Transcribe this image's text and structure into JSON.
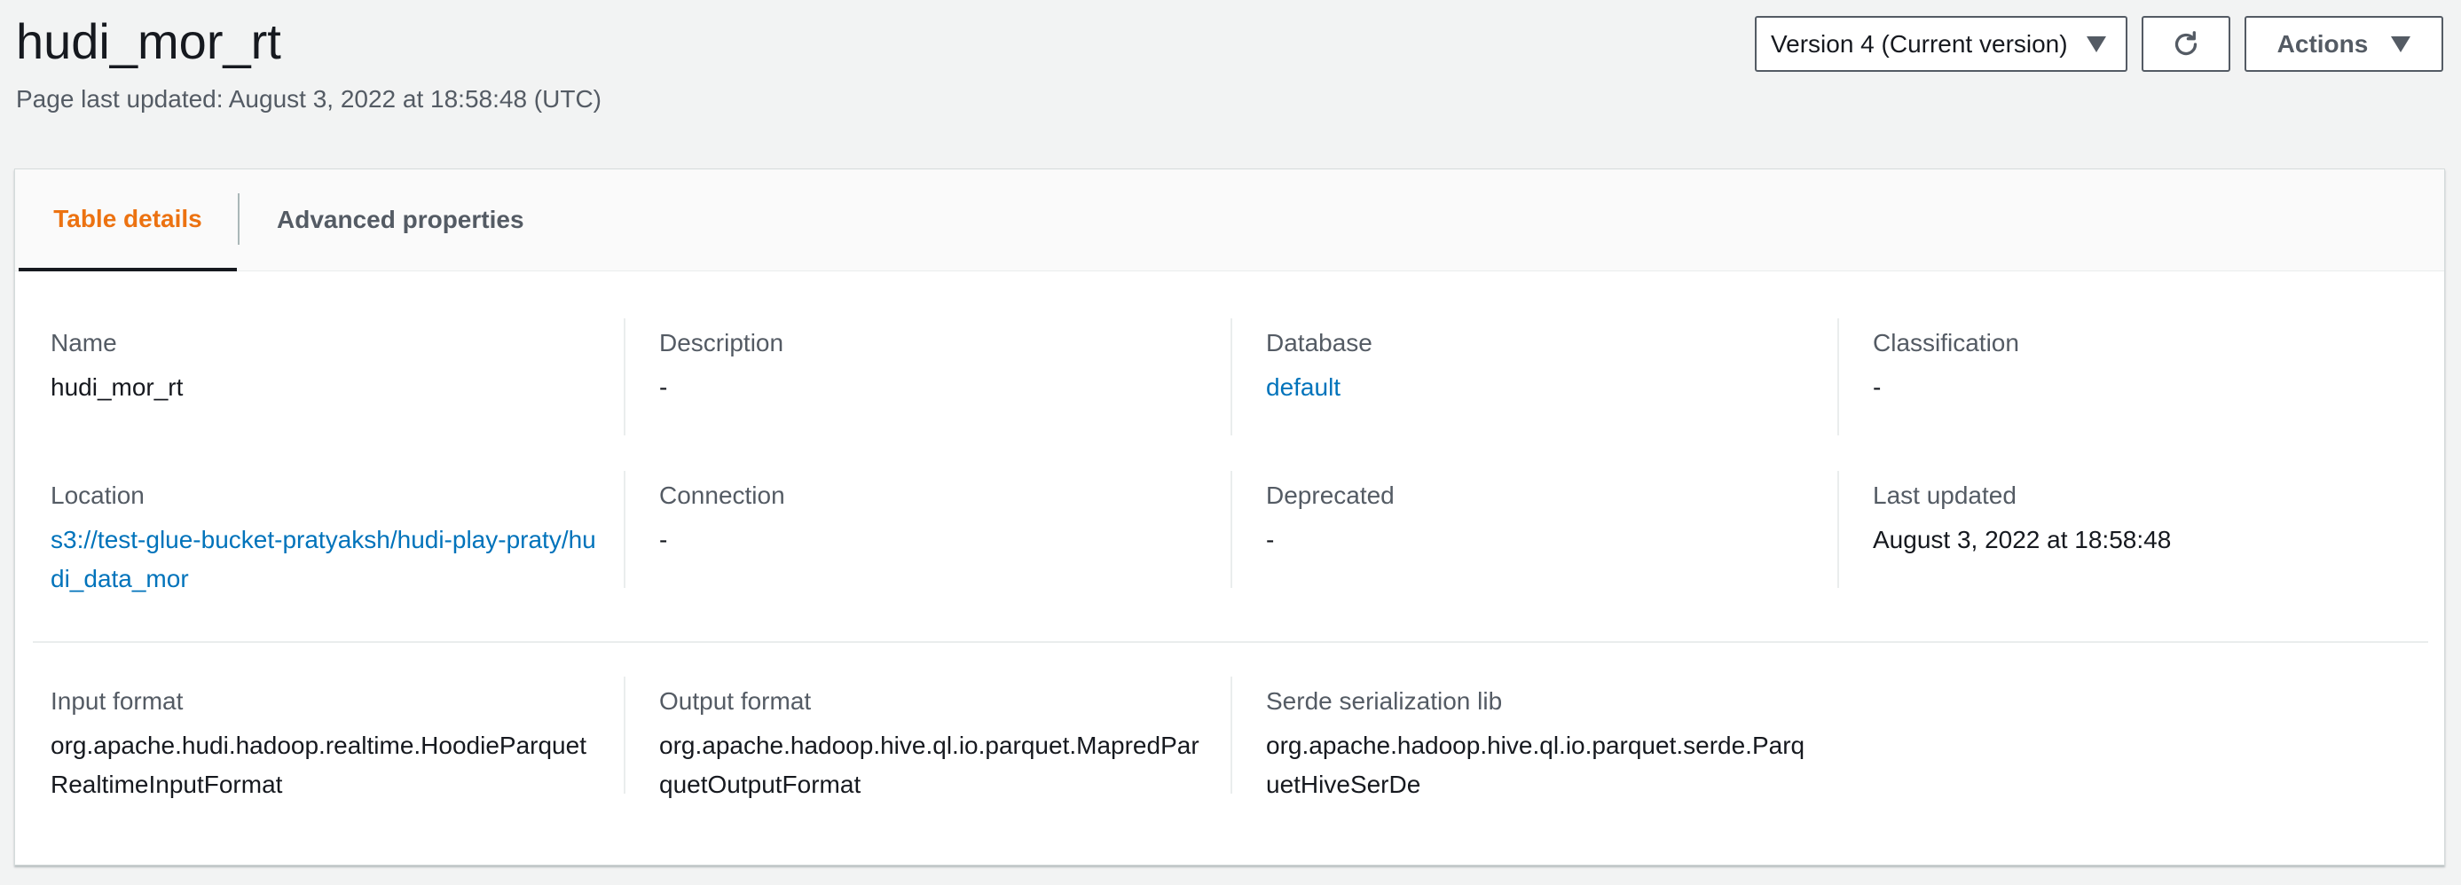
{
  "header": {
    "title": "hudi_mor_rt",
    "last_updated": "Page last updated: August 3, 2022 at 18:58:48 (UTC)",
    "version_select": "Version 4 (Current version)",
    "actions_label": "Actions"
  },
  "tabs": [
    {
      "label": "Table details",
      "active": true
    },
    {
      "label": "Advanced properties",
      "active": false
    }
  ],
  "details": {
    "name": {
      "label": "Name",
      "value": "hudi_mor_rt"
    },
    "description": {
      "label": "Description",
      "value": "-"
    },
    "database": {
      "label": "Database",
      "value": "default"
    },
    "classification": {
      "label": "Classification",
      "value": "-"
    },
    "location": {
      "label": "Location",
      "value": "s3://test-glue-bucket-pratyaksh/hudi-play-praty/hudi_data_mor"
    },
    "connection": {
      "label": "Connection",
      "value": "-"
    },
    "deprecated": {
      "label": "Deprecated",
      "value": "-"
    },
    "last_updated": {
      "label": "Last updated",
      "value": "August 3, 2022 at 18:58:48"
    },
    "input_format": {
      "label": "Input format",
      "value": "org.apache.hudi.hadoop.realtime.HoodieParquetRealtimeInputFormat"
    },
    "output_format": {
      "label": "Output format",
      "value": "org.apache.hadoop.hive.ql.io.parquet.MapredParquetOutputFormat"
    },
    "serde_lib": {
      "label": "Serde serialization lib",
      "value": "org.apache.hadoop.hive.ql.io.parquet.serde.ParquetHiveSerDe"
    }
  },
  "icons": {
    "refresh": "refresh-icon",
    "dropdown": "caret-down-icon"
  },
  "colors": {
    "active_tab": "#ec7211",
    "link": "#0073bb",
    "text": "#16191f",
    "muted": "#545b64",
    "background": "#f2f3f3"
  }
}
